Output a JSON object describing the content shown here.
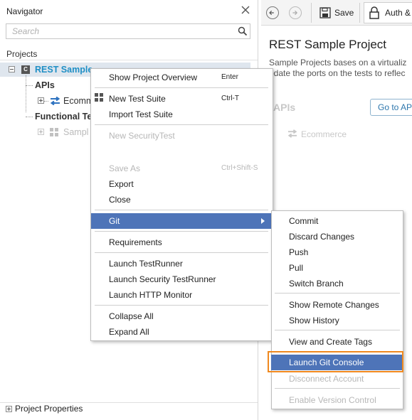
{
  "navigator": {
    "title": "Navigator",
    "search_placeholder": "Search",
    "projects_label": "Projects",
    "tree": {
      "project": "REST Sample",
      "project_icon_letter": "C",
      "apis": "APIs",
      "ecommerce": "Ecomm",
      "functional": "Functional Te",
      "sample": "Sampl"
    },
    "project_properties": "Project Properties"
  },
  "toolbar": {
    "save_label": "Save",
    "auth_label": "Auth &"
  },
  "editor": {
    "title": "REST Sample Project",
    "description_line1": "Sample Projects bases on a virtualiz",
    "description_line2": "pdate the ports on the tests to reflec",
    "apis_heading": "APIs",
    "goto_api_label": "Go to AP",
    "ecommerce_faded": "Ecommerce"
  },
  "context_menu": {
    "show_overview": "Show Project Overview",
    "show_overview_shortcut": "Enter",
    "new_test_suite": "New Test Suite",
    "new_test_suite_shortcut": "Ctrl-T",
    "import_test_suite": "Import Test Suite",
    "new_security_test": "New SecurityTest",
    "save_as": "Save As",
    "save_as_shortcut": "Ctrl+Shift-S",
    "export": "Export",
    "close": "Close",
    "git": "Git",
    "requirements": "Requirements",
    "launch_testrunner": "Launch TestRunner",
    "launch_security_testrunner": "Launch Security TestRunner",
    "launch_http_monitor": "Launch HTTP Monitor",
    "collapse_all": "Collapse All",
    "expand_all": "Expand All"
  },
  "git_menu": {
    "commit": "Commit",
    "discard_changes": "Discard Changes",
    "push": "Push",
    "pull": "Pull",
    "switch_branch": "Switch Branch",
    "show_remote_changes": "Show Remote Changes",
    "show_history": "Show History",
    "view_create_tags": "View and Create Tags",
    "launch_git_console": "Launch Git Console",
    "disconnect_account": "Disconnect Account",
    "enable_version_control": "Enable Version Control"
  },
  "colors": {
    "selection": "#4e74b8",
    "highlight_outline": "#f0891f",
    "project_name": "#1f8fc5"
  }
}
